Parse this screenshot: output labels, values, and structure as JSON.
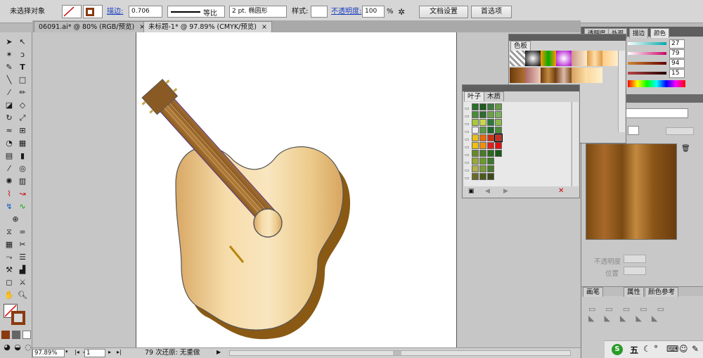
{
  "control_bar": {
    "selection_label": "未选择对象",
    "stroke_label": "描边:",
    "stroke_weight": "0.706",
    "profile_label": "等比",
    "brush_value": "2 pt. 椭圆形",
    "style_label": "样式:",
    "opacity_label": "不透明度:",
    "opacity_value": "100",
    "opacity_unit": "%",
    "doc_setup_button": "文档设置",
    "preferences_button": "首选项"
  },
  "tabs": [
    {
      "label": "06091.ai* @ 80% (RGB/预览)",
      "close": "×"
    },
    {
      "label": "未标题-1* @ 97.89% (CMYK/预览)",
      "close": "×"
    }
  ],
  "status_bar": {
    "zoom": "97.89%",
    "page": "1",
    "undo_info": "79 次还原: 无重做"
  },
  "swatches_panel": {
    "tab": "色板"
  },
  "pattern_panel": {
    "tabs": [
      "叶子",
      "木质"
    ]
  },
  "right_panel": {
    "tabs_top": [
      "透明度",
      "外观",
      "描边",
      "颜色"
    ],
    "color_values": [
      "27",
      "79",
      "94",
      "15"
    ],
    "opacity_label": "不透明度",
    "position_label": "位置",
    "bottom_tabs": [
      "画笔",
      "属性",
      "颜色参考"
    ]
  },
  "taskbar": {
    "ime": "五"
  },
  "colors": {
    "accent_link": "#1a3fbf",
    "guitar_body_light": "#f3d9a6",
    "guitar_body_dark": "#d8a763",
    "guitar_side": "#8a5a14",
    "neck": "#9b6a34"
  }
}
